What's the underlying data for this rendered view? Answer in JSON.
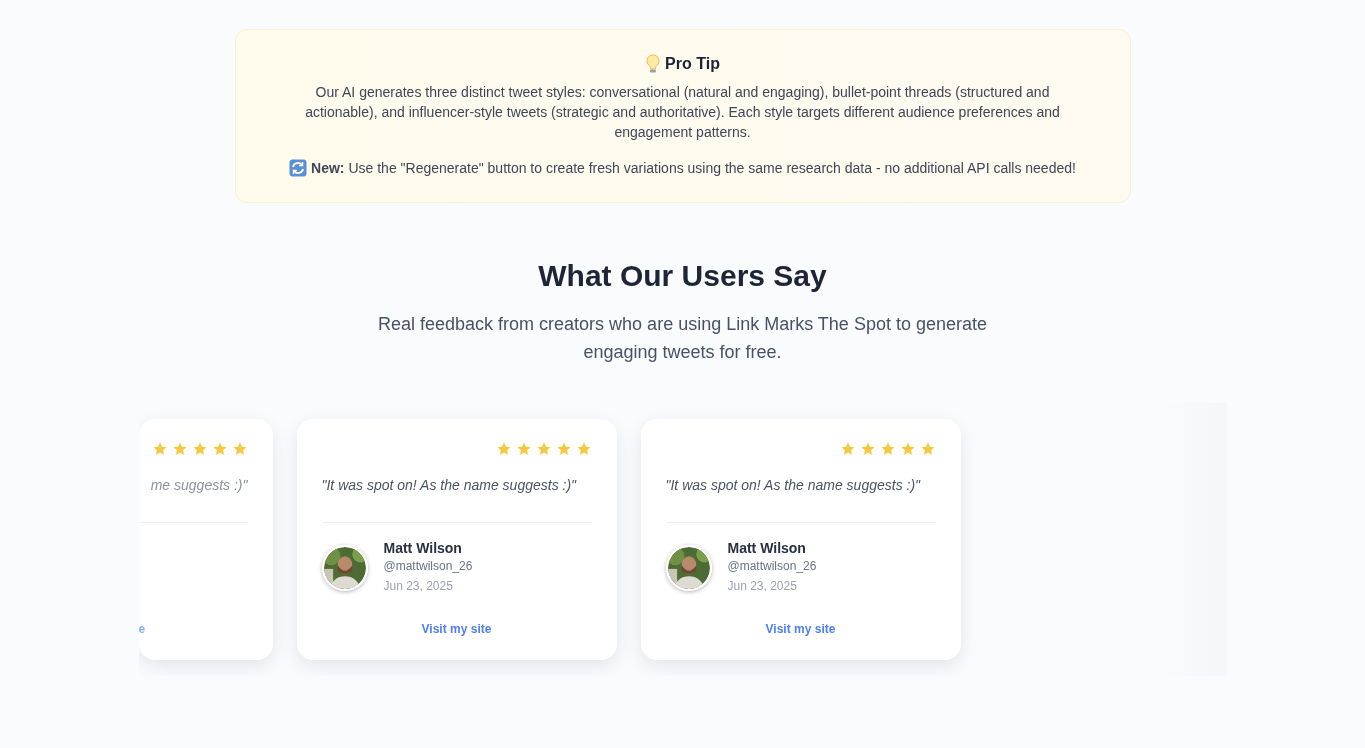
{
  "tip": {
    "title": "Pro Tip",
    "body": "Our AI generates three distinct tweet styles: conversational (natural and engaging), bullet-point threads (structured and actionable), and influencer-style tweets (strategic and authoritative). Each style targets different audience preferences and engagement patterns.",
    "note": "**New:** Use the \"Regenerate\" button to create fresh variations using the same research data - no additional API calls needed!"
  },
  "testimonials": {
    "title": "What Our Users Say",
    "subtitle": "Real feedback from creators who are using Link Marks The Spot to generate engaging tweets for free.",
    "cards": [
      {
        "kind": "partial",
        "stars": 5,
        "quote": "me suggests :)\"",
        "link": "e"
      },
      {
        "kind": "full",
        "stars": 5,
        "quote": "\"It was spot on! As the name suggests :)\"",
        "name": "Matt Wilson",
        "handle": "@mattwilson_26",
        "date": "Jun 23, 2025",
        "link": "Visit my site"
      },
      {
        "kind": "full",
        "stars": 5,
        "quote": "\"It was spot on! As the name suggests :)\"",
        "name": "Matt Wilson",
        "handle": "@mattwilson_26",
        "date": "Jun 23, 2025",
        "link": "Visit my site"
      }
    ]
  }
}
